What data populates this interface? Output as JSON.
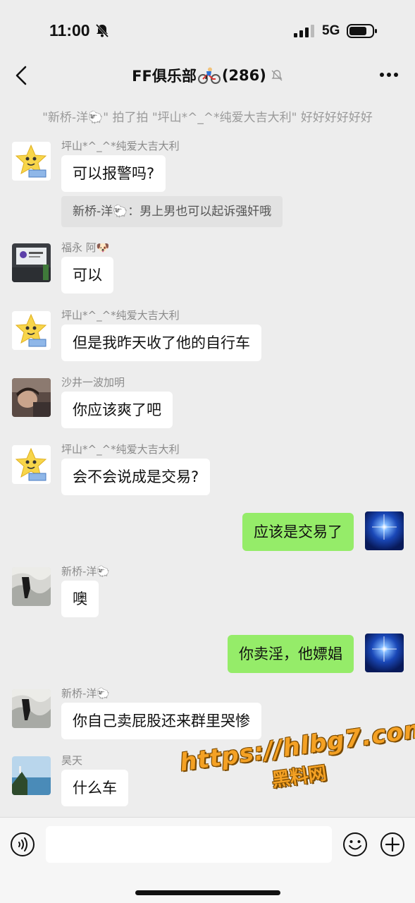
{
  "status_bar": {
    "time": "11:00",
    "network": "5G"
  },
  "header": {
    "title": "FF俱乐部",
    "count": "(286)"
  },
  "system_notice": {
    "text": "\"新桥-洋🐑\" 拍了拍 \"坪山*^_^*纯爱大吉大利\" 好好好好好好"
  },
  "messages": [
    {
      "sender": "坪山*^_^*纯爱大吉大利",
      "text": "可以报警吗?",
      "quote": "新桥-洋🐑：男上男也可以起诉强奸哦",
      "avatar": "star-avatar"
    },
    {
      "sender": "福永 阿🐶",
      "text": "可以",
      "avatar": "office-avatar"
    },
    {
      "sender": "坪山*^_^*纯爱大吉大利",
      "text": "但是我昨天收了他的自行车",
      "avatar": "star-avatar"
    },
    {
      "sender": "沙井一波加明",
      "text": "你应该爽了吧",
      "avatar": "person-avatar"
    },
    {
      "sender": "坪山*^_^*纯爱大吉大利",
      "text": "会不会说成是交易?",
      "avatar": "star-avatar"
    },
    {
      "sender": "me",
      "text": "应该是交易了",
      "avatar": "blue-star-avatar"
    },
    {
      "sender": "新桥-洋🐑",
      "text": "噢",
      "avatar": "wave-avatar"
    },
    {
      "sender": "me",
      "text": "你卖淫，他嫖娼",
      "avatar": "blue-star-avatar"
    },
    {
      "sender": "新桥-洋🐑",
      "text": "你自己卖屁股还来群里哭惨",
      "avatar": "wave-avatar"
    },
    {
      "sender": "昊天",
      "text": "什么车",
      "avatar": "sea-avatar"
    }
  ],
  "watermark": {
    "url": "https://hlbg7.com",
    "sub": "黑料网"
  },
  "input": {
    "placeholder": ""
  },
  "colors": {
    "background": "#ededed",
    "bubble_other": "#ffffff",
    "bubble_self": "#95ec69",
    "watermark": "#f4a124"
  }
}
